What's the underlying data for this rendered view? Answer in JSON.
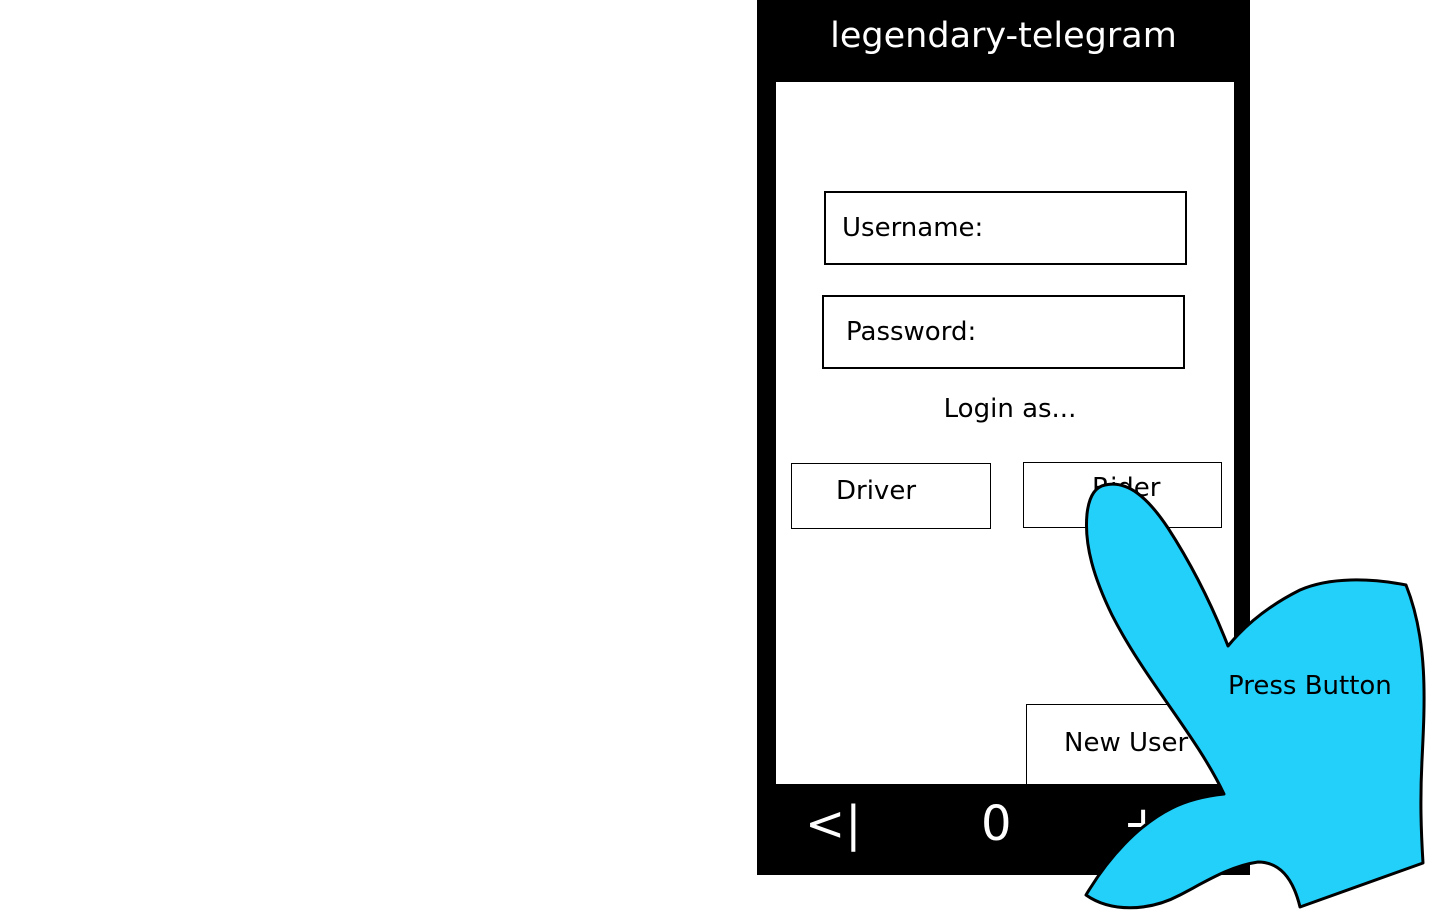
{
  "app": {
    "title": "legendary-telegram"
  },
  "login_form": {
    "username_label": "Username:",
    "password_label": "Password:",
    "login_as": "Login as...",
    "driver_label": "Driver",
    "rider_label": "Rider",
    "new_user_label": "New User"
  },
  "navbar": {
    "back_label": "<|",
    "home_label": "0",
    "menu_label": "+"
  },
  "annotation": {
    "label": "Press Button",
    "fill_color": "#22d0fa",
    "icon": "pointing-hand-icon"
  }
}
